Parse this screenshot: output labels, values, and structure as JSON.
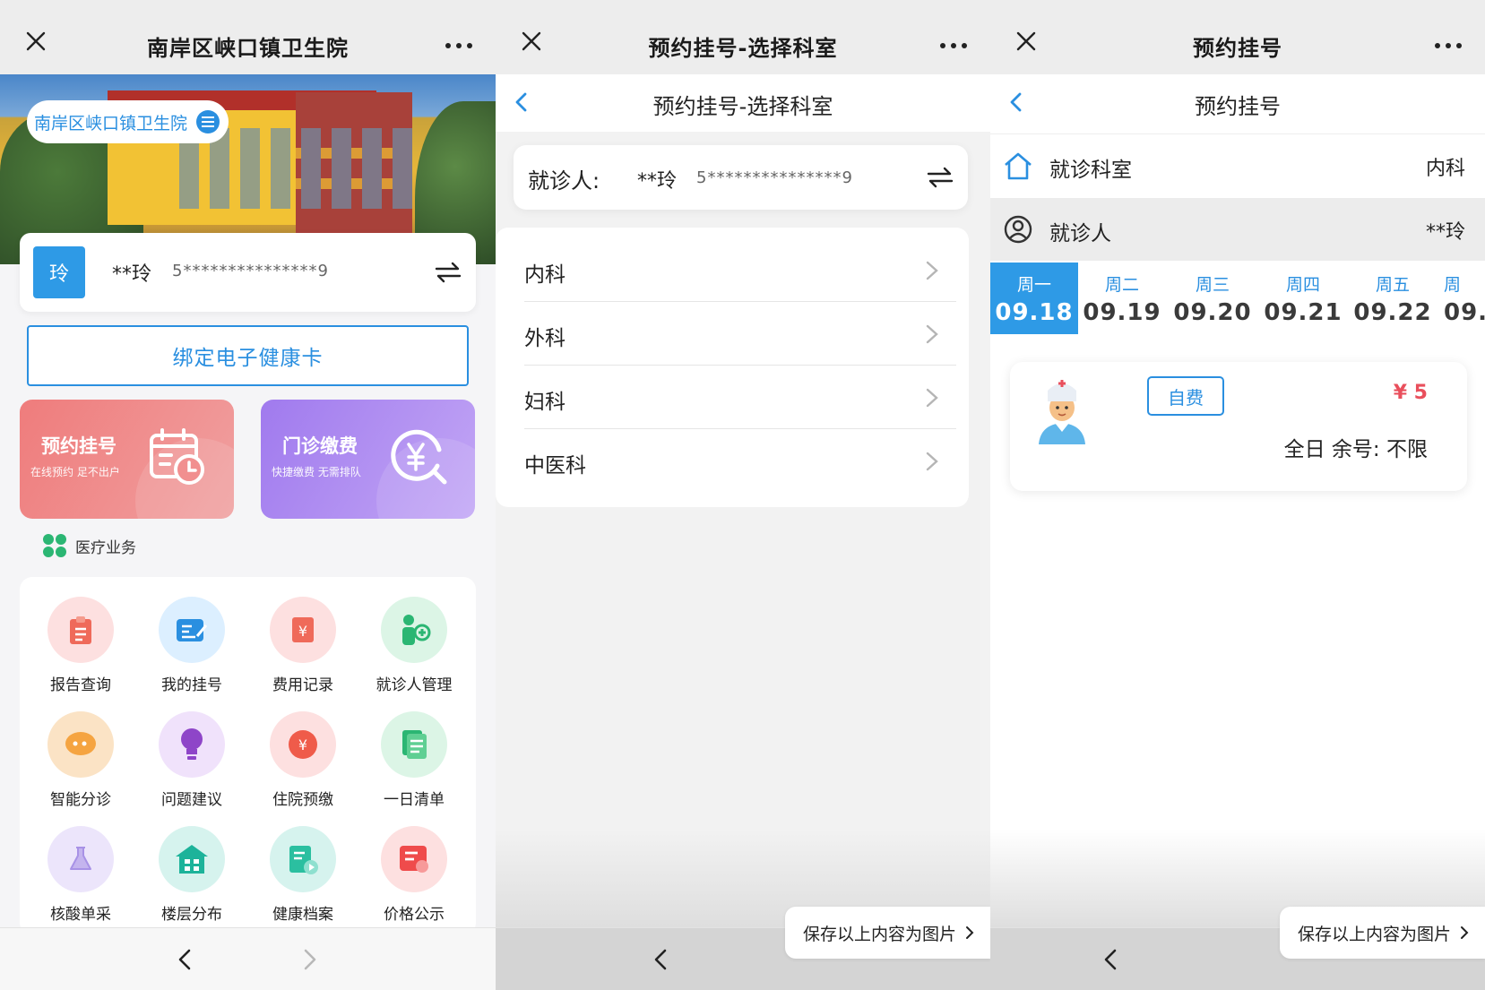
{
  "panel1": {
    "titlebar": {
      "title": "南岸区峡口镇卫生院"
    },
    "hero_badge": "南岸区峡口镇卫生院",
    "user_card": {
      "avatar_char": "玲",
      "name": "**玲",
      "id_masked": "5***************9"
    },
    "bind_button": "绑定电子健康卡",
    "tiles": [
      {
        "title": "预约挂号",
        "subtitle": "在线预约  足不出户"
      },
      {
        "title": "门诊缴费",
        "subtitle": "快捷缴费  无需排队"
      }
    ],
    "section_title": "医疗业务",
    "services": [
      {
        "label": "报告查询",
        "icon": "clipboard-icon"
      },
      {
        "label": "我的挂号",
        "icon": "register-card-icon"
      },
      {
        "label": "费用记录",
        "icon": "fee-record-icon"
      },
      {
        "label": "就诊人管理",
        "icon": "patient-manage-icon"
      },
      {
        "label": "智能分诊",
        "icon": "chat-bubble-icon"
      },
      {
        "label": "问题建议",
        "icon": "lightbulb-icon"
      },
      {
        "label": "住院预缴",
        "icon": "yuan-coin-icon"
      },
      {
        "label": "一日清单",
        "icon": "document-list-icon"
      },
      {
        "label": "核酸单采",
        "icon": "flask-icon"
      },
      {
        "label": "楼层分布",
        "icon": "building-icon"
      },
      {
        "label": "健康档案",
        "icon": "health-file-icon"
      },
      {
        "label": "价格公示",
        "icon": "price-board-icon"
      }
    ]
  },
  "panel2": {
    "titlebar": {
      "title": "预约挂号-选择科室"
    },
    "subtitle": "预约挂号-选择科室",
    "patient": {
      "label": "就诊人:",
      "name": "**玲",
      "id_masked": "5***************9"
    },
    "departments": [
      "内科",
      "外科",
      "妇科",
      "中医科"
    ],
    "save_button": "保存以上内容为图片"
  },
  "panel3": {
    "titlebar": {
      "title": "预约挂号"
    },
    "subtitle": "预约挂号",
    "department": {
      "label": "就诊科室",
      "value": "内科"
    },
    "patient": {
      "label": "就诊人",
      "value": "**玲"
    },
    "dates": [
      {
        "weekday": "周一",
        "date": "09.18",
        "selected": true
      },
      {
        "weekday": "周二",
        "date": "09.19"
      },
      {
        "weekday": "周三",
        "date": "09.20"
      },
      {
        "weekday": "周四",
        "date": "09.21"
      },
      {
        "weekday": "周五",
        "date": "09.22"
      },
      {
        "weekday": "周",
        "date": "09."
      }
    ],
    "slot": {
      "tag": "自费",
      "price": "¥ 5",
      "remaining": "全日 余号: 不限"
    },
    "save_button": "保存以上内容为图片"
  },
  "colors": {
    "accent_blue": "#2a8fe0",
    "red_tile": "#ef7c7c",
    "purple_tile": "#a07aee",
    "price_red": "#e94f5c"
  }
}
